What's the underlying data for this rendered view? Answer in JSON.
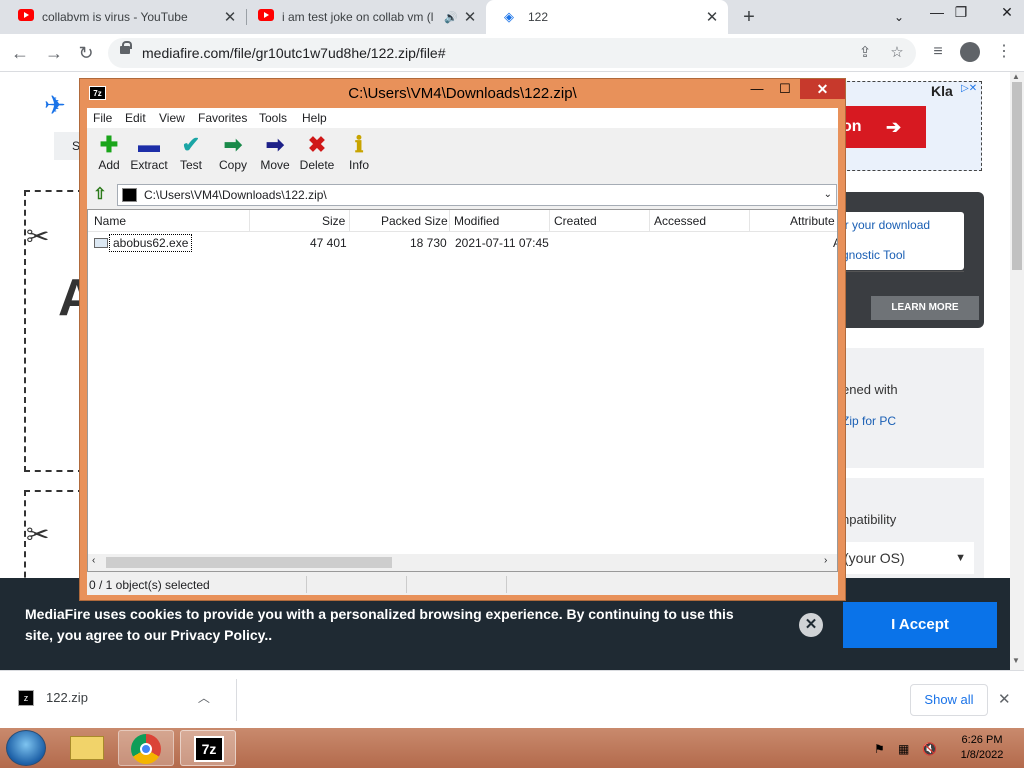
{
  "browser": {
    "tabs": [
      {
        "title": "collabvm is virus - YouTube"
      },
      {
        "title": "i am test joke on collab vm (l"
      },
      {
        "title": "122"
      }
    ],
    "url": "mediafire.com/file/gr10utc1w7ud8he/122.zip/file#"
  },
  "page": {
    "ad_button": "on",
    "ad_brand": "Kla",
    "link_download": "ir your download",
    "link_tool": "gnostic Tool",
    "learn_more": "LEARN MORE",
    "opened_with": "ened with",
    "zip_pc": "Zip for PC",
    "compat": "npatibility",
    "os_select": "(your OS)",
    "big_letter": "A",
    "nav_short": "S"
  },
  "cookie": {
    "text": "MediaFire uses cookies to provide you with a personalized browsing experience. By continuing to use this site, you agree to our Privacy Policy..",
    "accept": "I Accept"
  },
  "download_bar": {
    "file": "122.zip",
    "show_all": "Show all"
  },
  "sevenzip": {
    "title": "C:\\Users\\VM4\\Downloads\\122.zip\\",
    "app_icon": "7z",
    "menu": [
      "File",
      "Edit",
      "View",
      "Favorites",
      "Tools",
      "Help"
    ],
    "tools": [
      {
        "label": "Add",
        "icon": "add-icon",
        "color": "#1aa51a"
      },
      {
        "label": "Extract",
        "icon": "extract-icon",
        "color": "#1d2ea8"
      },
      {
        "label": "Test",
        "icon": "test-icon",
        "color": "#1aa5a5"
      },
      {
        "label": "Copy",
        "icon": "copy-icon",
        "color": "#1a8a4a"
      },
      {
        "label": "Move",
        "icon": "move-icon",
        "color": "#1d2088"
      },
      {
        "label": "Delete",
        "icon": "delete-icon",
        "color": "#d01818"
      },
      {
        "label": "Info",
        "icon": "info-icon",
        "color": "#c8a400"
      }
    ],
    "address": "C:\\Users\\VM4\\Downloads\\122.zip\\",
    "columns": [
      "Name",
      "Size",
      "Packed Size",
      "Modified",
      "Created",
      "Accessed",
      "Attribute"
    ],
    "files": [
      {
        "name": "abobus62.exe",
        "size": "47 401",
        "packed": "18 730",
        "modified": "2021-07-11 07:45",
        "attr": "A"
      }
    ],
    "status": "0 / 1 object(s) selected"
  },
  "taskbar": {
    "seven_zip_label": "7z",
    "time": "6:26 PM",
    "date": "1/8/2022"
  }
}
